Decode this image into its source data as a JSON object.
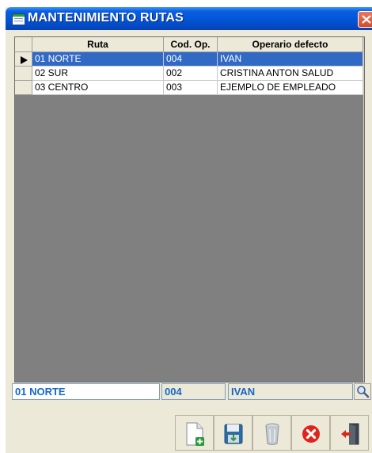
{
  "window": {
    "title": "MANTENIMIENTO RUTAS"
  },
  "table": {
    "columns": [
      "Ruta",
      "Cod. Op.",
      "Operario defecto"
    ],
    "rows": [
      {
        "ruta": "01 NORTE",
        "cod_op": "004",
        "operario": "IVAN"
      },
      {
        "ruta": "02 SUR",
        "cod_op": "002",
        "operario": "CRISTINA ANTON SALUD"
      },
      {
        "ruta": "03 CENTRO",
        "cod_op": "003",
        "operario": "EJEMPLO DE EMPLEADO"
      }
    ],
    "selected_row": 0
  },
  "detail": {
    "ruta": "01 NORTE",
    "cod_op": "004",
    "operario": "IVAN"
  },
  "toolbar": {
    "buttons": [
      "new-document-icon",
      "save-icon",
      "trash-bin-icon",
      "cancel-icon",
      "exit-door-icon"
    ]
  },
  "colors": {
    "accent": "#316ac5",
    "title_bar": "#0356d9",
    "field_text": "#1667c8",
    "panel": "#ece9d8",
    "grid_bg": "#808080"
  }
}
